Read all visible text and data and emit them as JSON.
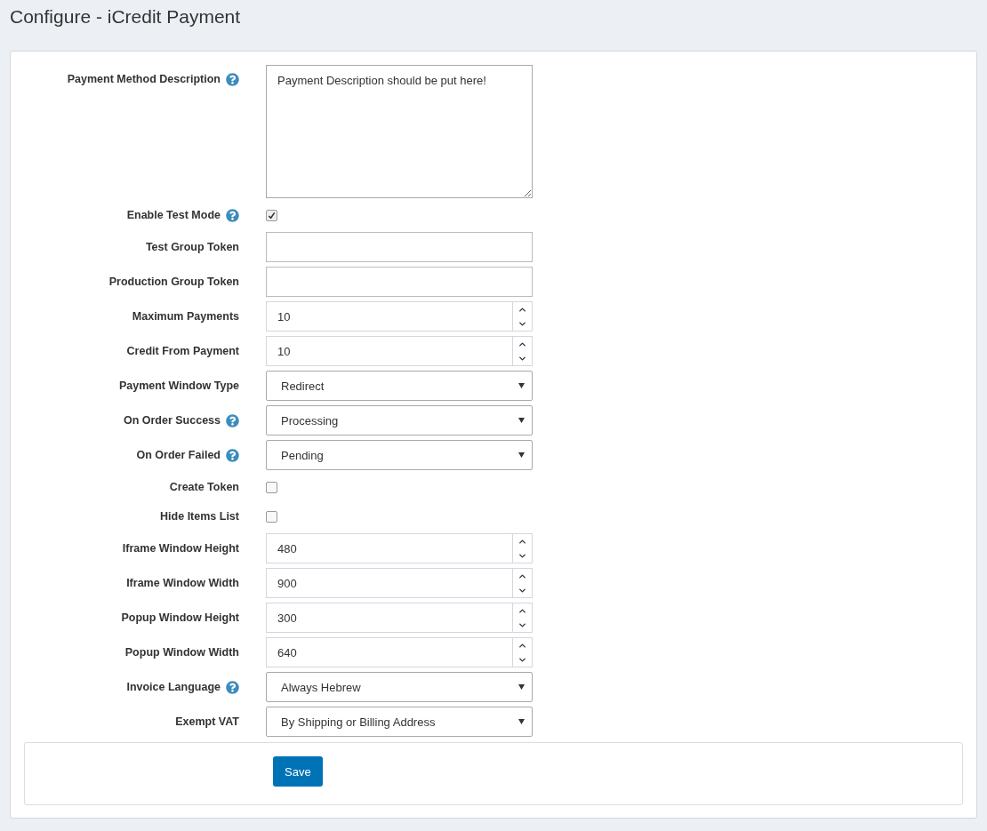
{
  "page": {
    "title": "Configure - iCredit Payment"
  },
  "fields": [
    {
      "kind": "textarea",
      "label": "Payment Method Description",
      "help": true,
      "value": "Payment Description should be put here!"
    },
    {
      "kind": "checkbox",
      "label": "Enable Test Mode",
      "help": true,
      "checked": true
    },
    {
      "kind": "text",
      "label": "Test Group Token",
      "help": false
    },
    {
      "kind": "text",
      "label": "Production Group Token",
      "help": false
    },
    {
      "kind": "number",
      "label": "Maximum Payments",
      "help": false,
      "value": "10"
    },
    {
      "kind": "number",
      "label": "Credit From Payment",
      "help": false,
      "value": "10"
    },
    {
      "kind": "select",
      "label": "Payment Window Type",
      "help": false,
      "value": "Redirect"
    },
    {
      "kind": "select",
      "label": "On Order Success",
      "help": true,
      "value": "Processing"
    },
    {
      "kind": "select",
      "label": "On Order Failed",
      "help": true,
      "value": "Pending"
    },
    {
      "kind": "checkbox",
      "label": "Create Token",
      "help": false,
      "checked": false
    },
    {
      "kind": "checkbox",
      "label": "Hide Items List",
      "help": false,
      "checked": false
    },
    {
      "kind": "number",
      "label": "Iframe Window Height",
      "help": false,
      "value": "480"
    },
    {
      "kind": "number",
      "label": "Iframe Window Width",
      "help": false,
      "value": "900"
    },
    {
      "kind": "number",
      "label": "Popup Window Height",
      "help": false,
      "value": "300"
    },
    {
      "kind": "number",
      "label": "Popup Window Width",
      "help": false,
      "value": "640"
    },
    {
      "kind": "select",
      "label": "Invoice Language",
      "help": true,
      "value": "Always Hebrew"
    },
    {
      "kind": "select",
      "label": "Exempt VAT",
      "help": false,
      "value": "By Shipping or Billing Address"
    }
  ],
  "save_button": "Save"
}
